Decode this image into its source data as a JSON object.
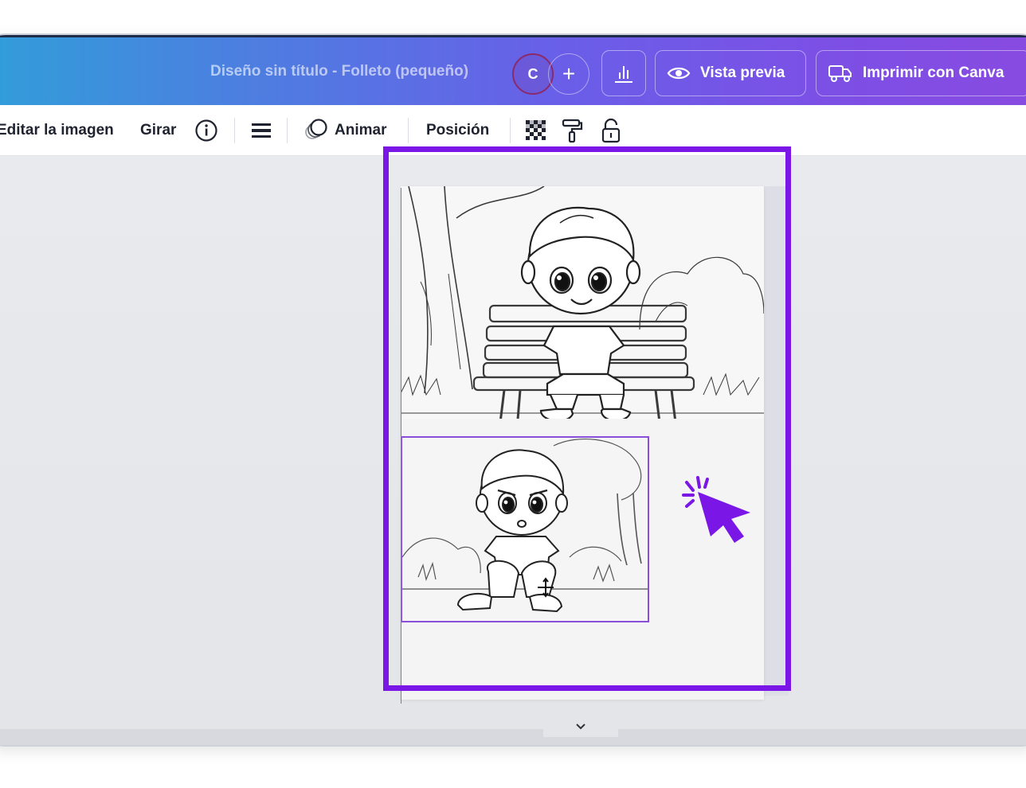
{
  "header": {
    "document_title": "Diseño sin título - Folleto (pequeño)",
    "avatar_initial": "C",
    "add_label": "+",
    "preview_label": "Vista previa",
    "print_label": "Imprimir con Canva"
  },
  "toolbar": {
    "edit_image_label": "Editar la imagen",
    "rotate_label": "Girar",
    "animate_label": "Animar",
    "position_label": "Posición"
  },
  "icons": [
    "chart-icon",
    "eye-icon",
    "truck-icon",
    "info-icon",
    "lines-icon",
    "animate-icon",
    "transparency-icon",
    "paint-roller-icon",
    "lock-icon",
    "click-cursor-icon",
    "chevron-down-icon",
    "move-icon"
  ],
  "colors": {
    "highlight": "#7a16e6",
    "selection": "#8a4fd8",
    "cursor": "#7a16e6"
  }
}
